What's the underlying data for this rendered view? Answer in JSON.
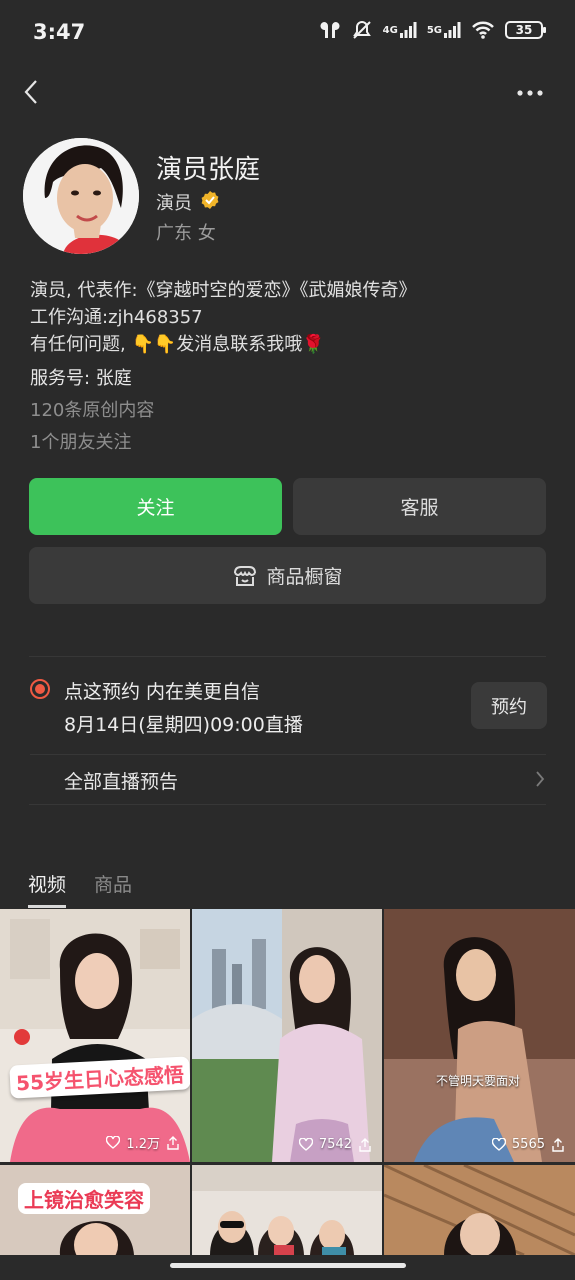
{
  "status_bar": {
    "time": "3:47",
    "network_4g": "4G",
    "network_5g": "5G",
    "battery": "35"
  },
  "profile": {
    "name": "演员张庭",
    "role": "演员",
    "region": "广东  女",
    "bio_lines": [
      "演员, 代表作:《穿越时空的爱恋》《武媚娘传奇》",
      "工作沟通:zjh468357",
      "有任何问题, 👇👇发消息联系我哦🌹"
    ],
    "service_account": "服务号: 张庭",
    "original_count": "120条原创内容",
    "friends_following": "1个朋友关注"
  },
  "buttons": {
    "follow": "关注",
    "customer_service": "客服",
    "shop_window": "商品橱窗"
  },
  "live": {
    "title": "点这预约 内在美更自信",
    "time": "8月14日(星期四)09:00直播",
    "reserve": "预约",
    "all_previews": "全部直播预告"
  },
  "tabs": [
    {
      "label": "视频",
      "active": true
    },
    {
      "label": "商品",
      "active": false
    }
  ],
  "videos": [
    {
      "likes": "1.2万",
      "caption": "55岁生日心态感悟"
    },
    {
      "likes": "7542",
      "caption": ""
    },
    {
      "likes": "5565",
      "caption": "不管明天要面对"
    },
    {
      "likes": "",
      "caption": "上镜治愈笑容"
    },
    {
      "likes": "",
      "caption": ""
    },
    {
      "likes": "",
      "caption": ""
    }
  ],
  "colors": {
    "background": "#2a2a2a",
    "follow_green": "#3dc25a",
    "live_red": "#ef5a43",
    "verified_gold": "#f0b429"
  }
}
